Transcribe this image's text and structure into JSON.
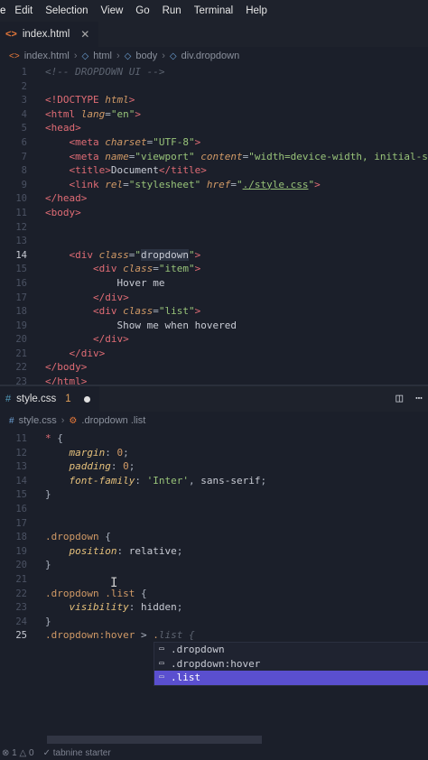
{
  "menubar": {
    "logo": "e",
    "items": [
      "Edit",
      "Selection",
      "View",
      "Go",
      "Run",
      "Terminal",
      "Help"
    ]
  },
  "top_tab": {
    "icon": "<>",
    "label": "index.html"
  },
  "top_breadcrumb": [
    "index.html",
    "html",
    "body",
    "div.dropdown"
  ],
  "html_lines": [
    {
      "n": "1",
      "indent": 1,
      "tokens": [
        [
          "cmt",
          "<!-- DROPDOWN UI -->"
        ]
      ]
    },
    {
      "n": "2",
      "indent": 0,
      "tokens": []
    },
    {
      "n": "3",
      "indent": 1,
      "tokens": [
        [
          "tag",
          "<!DOCTYPE "
        ],
        [
          "attr",
          "html"
        ],
        [
          "tag",
          ">"
        ]
      ]
    },
    {
      "n": "4",
      "indent": 1,
      "tokens": [
        [
          "tag",
          "<html "
        ],
        [
          "attr",
          "lang"
        ],
        [
          "punct",
          "="
        ],
        [
          "str",
          "\"en\""
        ],
        [
          "tag",
          ">"
        ]
      ]
    },
    {
      "n": "5",
      "indent": 1,
      "tokens": [
        [
          "tag",
          "<head>"
        ]
      ]
    },
    {
      "n": "6",
      "indent": 2,
      "tokens": [
        [
          "tag",
          "<meta "
        ],
        [
          "attr",
          "charset"
        ],
        [
          "punct",
          "="
        ],
        [
          "str",
          "\"UTF-8\""
        ],
        [
          "tag",
          ">"
        ]
      ]
    },
    {
      "n": "7",
      "indent": 2,
      "tokens": [
        [
          "tag",
          "<meta "
        ],
        [
          "attr",
          "name"
        ],
        [
          "punct",
          "="
        ],
        [
          "str",
          "\"viewport\""
        ],
        [
          "punct",
          " "
        ],
        [
          "attr",
          "content"
        ],
        [
          "punct",
          "="
        ],
        [
          "str",
          "\"width=device-width, initial-scal"
        ]
      ]
    },
    {
      "n": "8",
      "indent": 2,
      "tokens": [
        [
          "tag",
          "<title>"
        ],
        [
          "val",
          "Document"
        ],
        [
          "tag",
          "</title>"
        ]
      ]
    },
    {
      "n": "9",
      "indent": 2,
      "tokens": [
        [
          "tag",
          "<link "
        ],
        [
          "attr",
          "rel"
        ],
        [
          "punct",
          "="
        ],
        [
          "str",
          "\"stylesheet\""
        ],
        [
          "punct",
          " "
        ],
        [
          "attr",
          "href"
        ],
        [
          "punct",
          "="
        ],
        [
          "str",
          "\""
        ],
        [
          "link",
          "./style.css"
        ],
        [
          "str",
          "\""
        ],
        [
          "tag",
          ">"
        ]
      ]
    },
    {
      "n": "10",
      "indent": 1,
      "tokens": [
        [
          "tag",
          "</head>"
        ]
      ]
    },
    {
      "n": "11",
      "indent": 1,
      "tokens": [
        [
          "tag",
          "<body>"
        ]
      ]
    },
    {
      "n": "12",
      "indent": 0,
      "tokens": []
    },
    {
      "n": "13",
      "indent": 0,
      "tokens": []
    },
    {
      "n": "14",
      "indent": 2,
      "active": true,
      "tokens": [
        [
          "tag",
          "<div "
        ],
        [
          "attr",
          "class"
        ],
        [
          "punct",
          "="
        ],
        [
          "str",
          "\""
        ],
        [
          "hl",
          "dropdown"
        ],
        [
          "str",
          "\""
        ],
        [
          "tag",
          ">"
        ]
      ]
    },
    {
      "n": "15",
      "indent": 3,
      "tokens": [
        [
          "tag",
          "<div "
        ],
        [
          "attr",
          "class"
        ],
        [
          "punct",
          "="
        ],
        [
          "str",
          "\"item\""
        ],
        [
          "tag",
          ">"
        ]
      ]
    },
    {
      "n": "16",
      "indent": 4,
      "tokens": [
        [
          "val",
          "Hover me"
        ]
      ]
    },
    {
      "n": "17",
      "indent": 3,
      "tokens": [
        [
          "tag",
          "</div>"
        ]
      ]
    },
    {
      "n": "18",
      "indent": 3,
      "tokens": [
        [
          "tag",
          "<div "
        ],
        [
          "attr",
          "class"
        ],
        [
          "punct",
          "="
        ],
        [
          "str",
          "\"list\""
        ],
        [
          "tag",
          ">"
        ]
      ]
    },
    {
      "n": "19",
      "indent": 4,
      "tokens": [
        [
          "val",
          "Show me when hovered"
        ]
      ]
    },
    {
      "n": "20",
      "indent": 3,
      "tokens": [
        [
          "tag",
          "</div>"
        ]
      ]
    },
    {
      "n": "21",
      "indent": 2,
      "tokens": [
        [
          "tag",
          "</div>"
        ]
      ]
    },
    {
      "n": "22",
      "indent": 1,
      "tokens": [
        [
          "tag",
          "</body>"
        ]
      ]
    },
    {
      "n": "23",
      "indent": 1,
      "tokens": [
        [
          "tag",
          "</html>"
        ]
      ]
    }
  ],
  "bottom_tab": {
    "icon": "#",
    "label": "style.css",
    "badge": "1"
  },
  "bottom_breadcrumb": [
    "style.css",
    ".dropdown .list"
  ],
  "css_lines": [
    {
      "n": "11",
      "indent": 1,
      "tokens": [
        [
          "star",
          "* "
        ],
        [
          "punct",
          "{"
        ]
      ]
    },
    {
      "n": "12",
      "indent": 2,
      "tokens": [
        [
          "prop",
          "margin"
        ],
        [
          "punct",
          ": "
        ],
        [
          "num",
          "0"
        ],
        [
          "punct",
          ";"
        ]
      ]
    },
    {
      "n": "13",
      "indent": 2,
      "tokens": [
        [
          "prop",
          "padding"
        ],
        [
          "punct",
          ": "
        ],
        [
          "num",
          "0"
        ],
        [
          "punct",
          ";"
        ]
      ]
    },
    {
      "n": "14",
      "indent": 2,
      "tokens": [
        [
          "prop",
          "font-family"
        ],
        [
          "punct",
          ": "
        ],
        [
          "strc",
          "'Inter'"
        ],
        [
          "punct",
          ", "
        ],
        [
          "val",
          "sans-serif"
        ],
        [
          "punct",
          ";"
        ]
      ]
    },
    {
      "n": "15",
      "indent": 1,
      "tokens": [
        [
          "punct",
          "}"
        ]
      ]
    },
    {
      "n": "16",
      "indent": 0,
      "tokens": []
    },
    {
      "n": "17",
      "indent": 0,
      "tokens": []
    },
    {
      "n": "18",
      "indent": 1,
      "tokens": [
        [
          "sel",
          ".dropdown "
        ],
        [
          "punct",
          "{"
        ]
      ]
    },
    {
      "n": "19",
      "indent": 2,
      "tokens": [
        [
          "prop",
          "position"
        ],
        [
          "punct",
          ": "
        ],
        [
          "val",
          "relative"
        ],
        [
          "punct",
          ";"
        ]
      ]
    },
    {
      "n": "20",
      "indent": 1,
      "tokens": [
        [
          "punct",
          "}"
        ]
      ]
    },
    {
      "n": "21",
      "indent": 0,
      "tokens": []
    },
    {
      "n": "22",
      "indent": 1,
      "tokens": [
        [
          "sel",
          ".dropdown .list "
        ],
        [
          "punct",
          "{"
        ]
      ]
    },
    {
      "n": "23",
      "indent": 2,
      "tokens": [
        [
          "prop",
          "visibility"
        ],
        [
          "punct",
          ": "
        ],
        [
          "val",
          "hidden"
        ],
        [
          "punct",
          ";"
        ]
      ]
    },
    {
      "n": "24",
      "indent": 1,
      "tokens": [
        [
          "punct",
          "}"
        ]
      ]
    },
    {
      "n": "25",
      "indent": 1,
      "active": true,
      "tokens": [
        [
          "sel",
          ".dropdown:hover "
        ],
        [
          "punct",
          "> "
        ],
        [
          "sel",
          "."
        ],
        [
          "cmt",
          "list {"
        ]
      ]
    }
  ],
  "suggestions": [
    {
      "label": ".dropdown",
      "selected": false
    },
    {
      "label": ".dropdown:hover",
      "selected": false
    },
    {
      "label": ".list",
      "selected": true
    }
  ],
  "statusbar": {
    "problems": "1",
    "warnings": "0",
    "extension": "tabnine starter"
  }
}
